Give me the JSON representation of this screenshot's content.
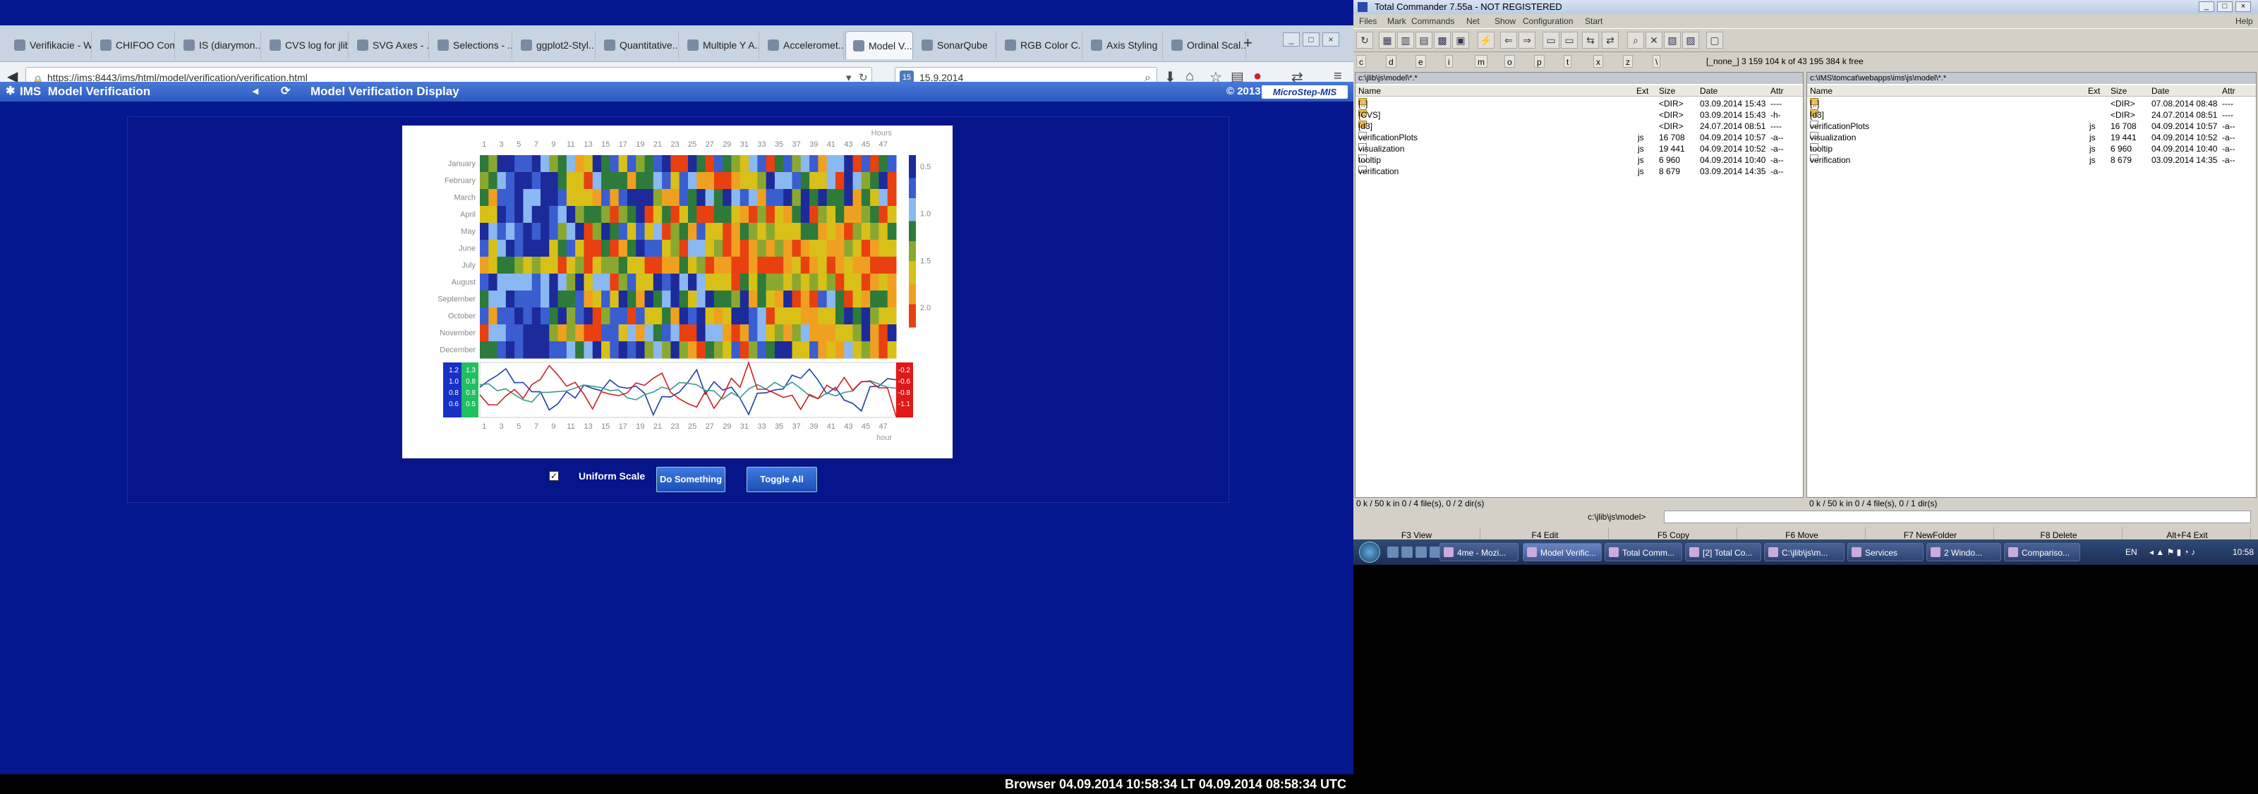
{
  "browser": {
    "tabs": [
      {
        "label": "Verifikacie - Wiki..."
      },
      {
        "label": "CHIFOO Compu..."
      },
      {
        "label": "IS (diarymon..."
      },
      {
        "label": "CVS log for jlib/j..."
      },
      {
        "label": "SVG Axes - ..."
      },
      {
        "label": "Selections - ..."
      },
      {
        "label": "ggplot2-Styl..."
      },
      {
        "label": "Quantitative..."
      },
      {
        "label": "Multiple Y A..."
      },
      {
        "label": "Acceleromet..."
      },
      {
        "label": "Model V..."
      },
      {
        "label": "SonarQube"
      },
      {
        "label": "RGB Color C..."
      },
      {
        "label": "Axis Styling"
      },
      {
        "label": "Ordinal Scal..."
      }
    ],
    "new_tab": "+",
    "url": "https://ims:8443/ims/html/model/verification/verification.html",
    "search_value": "15.9.2014",
    "app": {
      "logo_text": "IMS",
      "module": "Model Verification",
      "title": "Model Verification Display",
      "copyright": "© 2013",
      "brand": "MicroStep-MIS"
    },
    "controls": {
      "uniform_scale_label": "Uniform Scale",
      "uniform_checked": "✓",
      "do_something_label": "Do Something",
      "toggle_all_label": "Toggle All"
    },
    "status": "Browser   04.09.2014 10:58:34 LT   04.09.2014 08:58:34 UTC"
  },
  "chart_data": {
    "type": "heatmap",
    "top_axis_label": "Hours",
    "bottom_axis_label": "hour",
    "x_ticks": [
      "1",
      "3",
      "5",
      "7",
      "9",
      "11",
      "13",
      "15",
      "17",
      "19",
      "21",
      "23",
      "25",
      "27",
      "29",
      "31",
      "33",
      "35",
      "37",
      "39",
      "41",
      "43",
      "45",
      "47"
    ],
    "rows": [
      "January",
      "February",
      "March",
      "April",
      "May",
      "June",
      "July",
      "August",
      "September",
      "October",
      "November",
      "December"
    ],
    "colorbar_ticks": [
      "0.5",
      "1.0",
      "1.5",
      "2.0"
    ],
    "left_legend": [
      {
        "blue": "1.2",
        "green": "1.3"
      },
      {
        "blue": "1.0",
        "green": "0.8"
      },
      {
        "blue": "0.8",
        "green": "0.8"
      },
      {
        "blue": "0.6",
        "green": "0.5"
      }
    ],
    "right_legend": [
      "-0.2",
      "-0.6",
      "-0.8",
      "-1.1"
    ],
    "line_colors": {
      "blue": "#1f3fa8",
      "teal": "#3a9a8a",
      "red": "#d02020"
    },
    "palette": [
      "#1c2a9a",
      "#3a5ed0",
      "#8ab8f0",
      "#2e7a3a",
      "#8aa830",
      "#d8c018",
      "#f0a020",
      "#e84010"
    ]
  },
  "total_commander": {
    "title": "Total Commander 7.55a - NOT REGISTERED",
    "menu": [
      "Files",
      "Mark",
      "Commands",
      "Net",
      "Show",
      "Configuration",
      "Start"
    ],
    "help": "Help",
    "drive_info": "[_none_]  3 159 104 k of 43 195 384 k free",
    "left": {
      "path": "c:\\jlib\\js\\model\\*.*",
      "columns": {
        "name": "Name",
        "ext": "Ext",
        "size": "Size",
        "date": "Date",
        "attr": "Attr"
      },
      "rows": [
        {
          "name": "[..]",
          "ext": "",
          "size": "<DIR>",
          "date": "03.09.2014 15:43",
          "attr": "----",
          "icon": "up"
        },
        {
          "name": "[CVS]",
          "ext": "",
          "size": "<DIR>",
          "date": "03.09.2014 15:43",
          "attr": "-h-",
          "icon": "dir"
        },
        {
          "name": "[d3]",
          "ext": "",
          "size": "<DIR>",
          "date": "24.07.2014 08:51",
          "attr": "----",
          "icon": "dir"
        },
        {
          "name": "verificationPlots",
          "ext": "js",
          "size": "16 708",
          "date": "04.09.2014 10:57",
          "attr": "-a--",
          "icon": "file"
        },
        {
          "name": "visualization",
          "ext": "js",
          "size": "19 441",
          "date": "04.09.2014 10:52",
          "attr": "-a--",
          "icon": "file"
        },
        {
          "name": "tooltip",
          "ext": "js",
          "size": "6 960",
          "date": "04.09.2014 10:40",
          "attr": "-a--",
          "icon": "file"
        },
        {
          "name": "verification",
          "ext": "js",
          "size": "8 679",
          "date": "03.09.2014 14:35",
          "attr": "-a--",
          "icon": "file"
        }
      ],
      "footer": "0 k / 50 k in 0 / 4 file(s), 0 / 2 dir(s)"
    },
    "right": {
      "path": "c:\\IMS\\tomcat\\webapps\\ims\\js\\model\\*.*",
      "columns": {
        "name": "Name",
        "ext": "Ext",
        "size": "Size",
        "date": "Date",
        "attr": "Attr"
      },
      "rows": [
        {
          "name": "[..]",
          "ext": "",
          "size": "<DIR>",
          "date": "07.08.2014 08:48",
          "attr": "----",
          "icon": "up"
        },
        {
          "name": "[d3]",
          "ext": "",
          "size": "<DIR>",
          "date": "24.07.2014 08:51",
          "attr": "----",
          "icon": "dir"
        },
        {
          "name": "verificationPlots",
          "ext": "js",
          "size": "16 708",
          "date": "04.09.2014 10:57",
          "attr": "-a--",
          "icon": "file"
        },
        {
          "name": "visualization",
          "ext": "js",
          "size": "19 441",
          "date": "04.09.2014 10:52",
          "attr": "-a--",
          "icon": "file"
        },
        {
          "name": "tooltip",
          "ext": "js",
          "size": "6 960",
          "date": "04.09.2014 10:40",
          "attr": "-a--",
          "icon": "file"
        },
        {
          "name": "verification",
          "ext": "js",
          "size": "8 679",
          "date": "03.09.2014 14:35",
          "attr": "-a--",
          "icon": "file"
        }
      ],
      "footer": "0 k / 50 k in 0 / 4 file(s), 0 / 1 dir(s)"
    },
    "cmd_path": "c:\\jlib\\js\\model>",
    "fkeys": [
      "F3 View",
      "F4 Edit",
      "F5 Copy",
      "F6 Move",
      "F7 NewFolder",
      "F8 Delete",
      "Alt+F4 Exit"
    ]
  },
  "taskbar": {
    "tasks": [
      "4me - Mozi...",
      "Model Verific...",
      "Total Comm...",
      "[2] Total Co...",
      "C:\\jlib\\js\\m...",
      "Services",
      "2 Windo...",
      "Compariso..."
    ],
    "lang": "EN",
    "clock": "10:58"
  }
}
